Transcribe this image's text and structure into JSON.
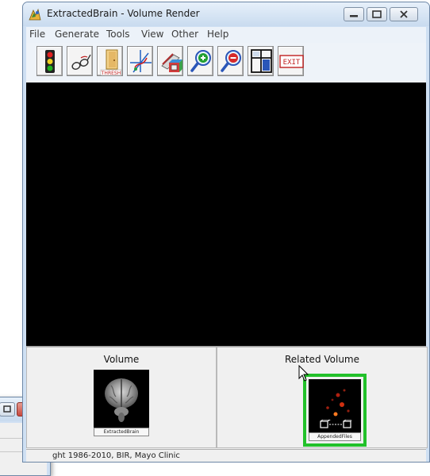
{
  "window": {
    "title": "ExtractedBrain - Volume Render",
    "controls": [
      "minimize",
      "maximize",
      "close"
    ]
  },
  "menu": {
    "items": [
      "File",
      "Generate",
      "Tools",
      "View",
      "Other",
      "Help"
    ]
  },
  "toolbar": {
    "buttons": [
      {
        "name": "traffic-light-icon"
      },
      {
        "name": "glasses-icon"
      },
      {
        "name": "thresh-door-icon",
        "label": "THRESH"
      },
      {
        "name": "axes-icon"
      },
      {
        "name": "color-cube-icon"
      },
      {
        "name": "zoom-in-icon"
      },
      {
        "name": "zoom-out-icon"
      },
      {
        "name": "layout-panes-icon"
      },
      {
        "name": "exit-icon",
        "label": "EXIT"
      }
    ]
  },
  "thumbnails": {
    "volume": {
      "title": "Volume",
      "label": "ExtractedBrain"
    },
    "related": {
      "title": "Related Volume",
      "label": "AppendedFiles"
    }
  },
  "status": {
    "text": "ght 1986-2010, BIR, Mayo Clinic"
  },
  "colors": {
    "highlight": "#22c12a",
    "viewport": "#000000",
    "titlebar": "#cfe0f3",
    "close": "#c8473d"
  }
}
